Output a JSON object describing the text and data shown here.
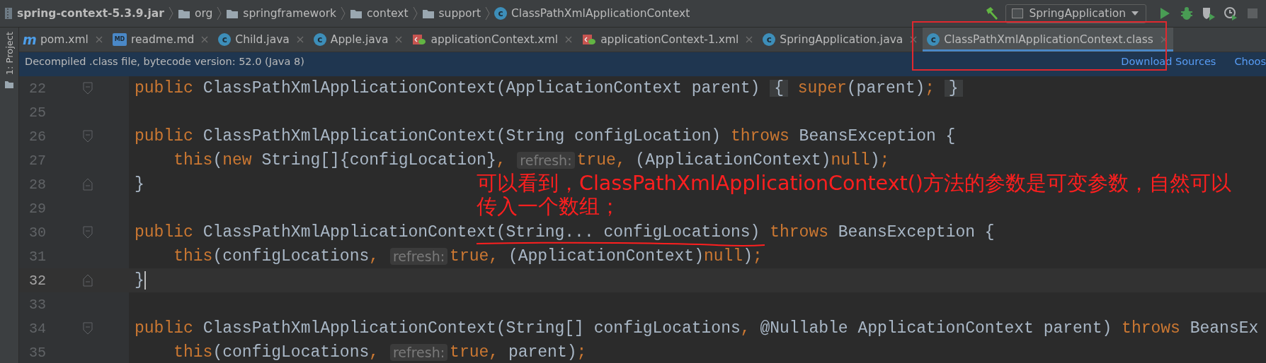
{
  "breadcrumb": [
    {
      "kind": "jar",
      "label": "spring-context-5.3.9.jar"
    },
    {
      "kind": "folder",
      "label": "org"
    },
    {
      "kind": "folder",
      "label": "springframework"
    },
    {
      "kind": "folder",
      "label": "context"
    },
    {
      "kind": "folder",
      "label": "support"
    },
    {
      "kind": "class",
      "glyph": "c",
      "label": "ClassPathXmlApplicationContext"
    }
  ],
  "run_config": {
    "label": "SpringApplication"
  },
  "side_panel": {
    "label": "1: Project"
  },
  "tabs": [
    {
      "kind": "maven",
      "glyph": "m",
      "label": "pom.xml",
      "selected": false
    },
    {
      "kind": "markdown",
      "glyph": "MD",
      "label": "readme.md",
      "selected": false
    },
    {
      "kind": "class",
      "glyph": "c",
      "label": "Child.java",
      "selected": false
    },
    {
      "kind": "class",
      "glyph": "c",
      "label": "Apple.java",
      "selected": false
    },
    {
      "kind": "xml",
      "label": "applicationContext.xml",
      "selected": false
    },
    {
      "kind": "xml",
      "label": "applicationContext-1.xml",
      "selected": false
    },
    {
      "kind": "class",
      "glyph": "c",
      "label": "SpringApplication.java",
      "selected": false
    },
    {
      "kind": "class",
      "glyph": "c",
      "label": "ClassPathXmlApplicationContext.class",
      "selected": true
    }
  ],
  "info_bar": {
    "message": "Decompiled .class file, bytecode version: 52.0 (Java 8)",
    "links": [
      "Download Sources",
      "Choos"
    ]
  },
  "code": {
    "lines": [
      {
        "number": "22",
        "current": false,
        "kind": "fold-start",
        "tokens": [
          {
            "kind": "kw",
            "t": "public"
          },
          {
            "kind": "id",
            "t": " ClassPathXmlApplicationContext(ApplicationContext parent) "
          },
          {
            "kind": "fold",
            "t": "{"
          },
          {
            "kind": "kw",
            "t": " super"
          },
          {
            "kind": "id",
            "t": "(parent)"
          },
          {
            "kind": "kw",
            "t": "; "
          },
          {
            "kind": "fold",
            "t": "}"
          }
        ]
      },
      {
        "number": "25",
        "current": false,
        "kind": "plain"
      },
      {
        "number": "26",
        "current": false,
        "kind": "fold-start",
        "tokens": [
          {
            "kind": "kw",
            "t": "public"
          },
          {
            "kind": "id",
            "t": " ClassPathXmlApplicationContext(String configLocation) "
          },
          {
            "kind": "kw",
            "t": "throws"
          },
          {
            "kind": "id",
            "t": " BeansException {"
          }
        ]
      },
      {
        "number": "27",
        "current": false,
        "kind": "plain",
        "tokens": [
          {
            "kind": "kw",
            "t": "    this"
          },
          {
            "kind": "id",
            "t": "("
          },
          {
            "kind": "kw",
            "t": "new"
          },
          {
            "kind": "id",
            "t": " String[]{configLocation}"
          },
          {
            "kind": "kw",
            "t": ", "
          },
          {
            "kind": "hint",
            "t": "refresh:"
          },
          {
            "kind": "kw",
            "t": "true,"
          },
          {
            "kind": "id",
            "t": " (ApplicationContext)"
          },
          {
            "kind": "kw",
            "t": "null"
          },
          {
            "kind": "id",
            "t": ")"
          },
          {
            "kind": "kw",
            "t": ";"
          }
        ]
      },
      {
        "number": "28",
        "current": false,
        "kind": "fold-end",
        "tokens": [
          {
            "kind": "id",
            "t": "}"
          }
        ]
      },
      {
        "number": "29",
        "current": false,
        "kind": "plain"
      },
      {
        "number": "30",
        "current": false,
        "kind": "fold-start",
        "tokens": [
          {
            "kind": "kw",
            "t": "public"
          },
          {
            "kind": "id",
            "t": " ClassPathXmlApplicationContext(String... configLocations) "
          },
          {
            "kind": "kw",
            "t": "throws"
          },
          {
            "kind": "id",
            "t": " BeansException {"
          }
        ]
      },
      {
        "number": "31",
        "current": false,
        "kind": "plain",
        "tokens": [
          {
            "kind": "kw",
            "t": "    this"
          },
          {
            "kind": "id",
            "t": "(configLocations"
          },
          {
            "kind": "kw",
            "t": ", "
          },
          {
            "kind": "hint",
            "t": "refresh:"
          },
          {
            "kind": "kw",
            "t": "true,"
          },
          {
            "kind": "id",
            "t": " (ApplicationContext)"
          },
          {
            "kind": "kw",
            "t": "null"
          },
          {
            "kind": "id",
            "t": ")"
          },
          {
            "kind": "kw",
            "t": ";"
          }
        ]
      },
      {
        "number": "32",
        "current": true,
        "kind": "fold-end",
        "tokens": [
          {
            "kind": "id",
            "t": "}"
          }
        ]
      },
      {
        "number": "33",
        "current": false,
        "kind": "plain"
      },
      {
        "number": "34",
        "current": false,
        "kind": "fold-start",
        "tokens": [
          {
            "kind": "kw",
            "t": "public"
          },
          {
            "kind": "id",
            "t": " ClassPathXmlApplicationContext(String[] configLocations"
          },
          {
            "kind": "kw",
            "t": ","
          },
          {
            "kind": "id",
            "t": " @Nullable ApplicationContext parent) "
          },
          {
            "kind": "kw",
            "t": "throws"
          },
          {
            "kind": "id",
            "t": " BeansEx"
          }
        ]
      },
      {
        "number": "35",
        "current": false,
        "kind": "plain",
        "tokens": [
          {
            "kind": "kw",
            "t": "    this"
          },
          {
            "kind": "id",
            "t": "(configLocations"
          },
          {
            "kind": "kw",
            "t": ", "
          },
          {
            "kind": "hint",
            "t": "refresh:"
          },
          {
            "kind": "kw",
            "t": "true,"
          },
          {
            "kind": "id",
            "t": " parent)"
          },
          {
            "kind": "kw",
            "t": ";"
          }
        ]
      }
    ]
  },
  "annotation": {
    "lines": [
      "可以看到，ClassPathXmlApplicationContext()方法的参数是可变参数，自然可以",
      "传入一个数组；"
    ]
  }
}
